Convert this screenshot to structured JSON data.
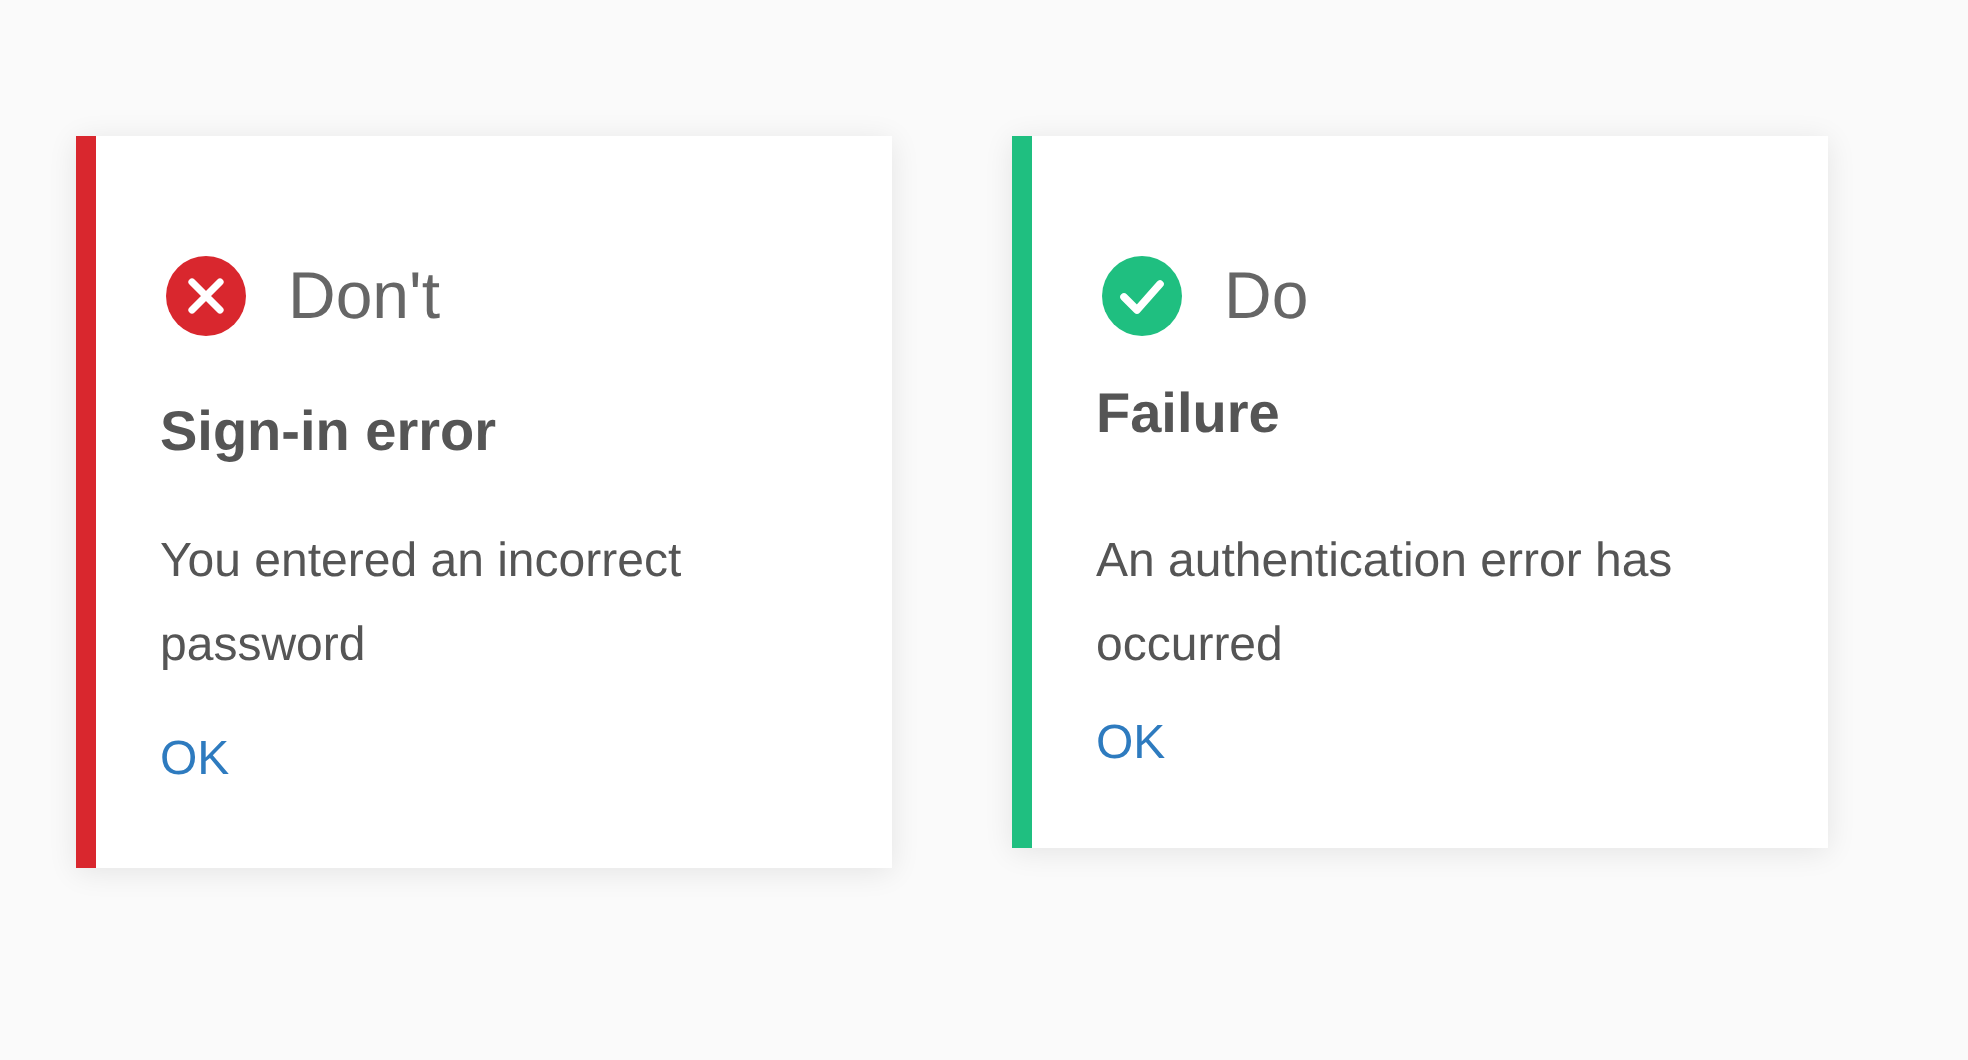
{
  "cards": [
    {
      "kind": "dont",
      "verdict": "Don't",
      "title": "Sign-in error",
      "message": "You entered an incorrect password",
      "action": "OK"
    },
    {
      "kind": "do",
      "verdict": "Do",
      "title": "Failure",
      "message": "An authentication error has occurred",
      "action": "OK"
    }
  ]
}
